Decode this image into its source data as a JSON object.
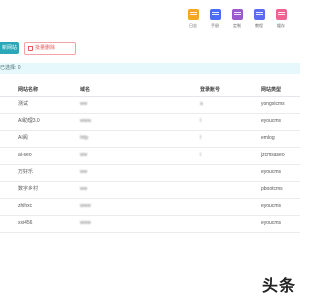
{
  "toolbar_icons": [
    {
      "name": "log-icon",
      "label": "日志",
      "color": "#f5a623"
    },
    {
      "name": "manual-icon",
      "label": "手册",
      "color": "#4a6cf7"
    },
    {
      "name": "custom-icon",
      "label": "定制",
      "color": "#9b59d0"
    },
    {
      "name": "tutorial-icon",
      "label": "教程",
      "color": "#5b6cf0"
    },
    {
      "name": "cache-icon",
      "label": "缓存",
      "color": "#f06292"
    }
  ],
  "buttons": {
    "add_label": "新网站",
    "batch_delete_label": "批量删除"
  },
  "selection": {
    "text": "已选择: 0"
  },
  "table": {
    "headers": [
      "网站名称",
      "域名",
      "登录账号",
      "网站类型"
    ],
    "rows": [
      {
        "name": "测试",
        "domain": "ww",
        "account": "a",
        "type": "yongxicms"
      },
      {
        "name": "AI助理3.0",
        "domain": "www.",
        "account": "l",
        "type": "eyoucms"
      },
      {
        "name": "AI阁",
        "domain": "http",
        "account": "l",
        "type": "emlog"
      },
      {
        "name": "ai-seo",
        "domain": "ww",
        "account": "i",
        "type": "jzcmsaseo"
      },
      {
        "name": "万好乐",
        "domain": "ww",
        "account": "",
        "type": "eyoucms"
      },
      {
        "name": "数字乡村",
        "domain": "ww",
        "account": "",
        "type": "pbootcms"
      },
      {
        "name": "zhihxc",
        "domain": "www",
        "account": "",
        "type": "eyoucms"
      },
      {
        "name": "xxi456",
        "domain": "www",
        "account": "",
        "type": "eyoucms"
      }
    ]
  },
  "watermark": "头条"
}
